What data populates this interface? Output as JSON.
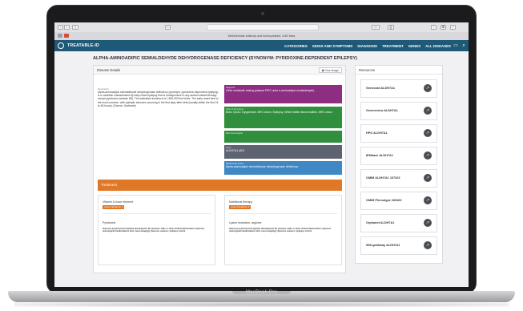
{
  "browser": {
    "tab_title": "Methotrexate antibody and homocysteine, LMD floss",
    "laptop_label": "MacBook Pro"
  },
  "nav": {
    "brand": "TREATABLE-ID",
    "links": [
      "CATEGORIES",
      "SIGNS AND SYMPTOMS",
      "DIAGNOSIS",
      "TREATMENT",
      "GENES",
      "ALL DISEASES"
    ]
  },
  "page": {
    "title": "ALPHA-AMINOADIPIC SEMIALDEHYDE DEHYDROGENASE DEFICIENCY (SYNONYM: PYRIDOXINE-DEPENDENT EPILEPSY)"
  },
  "details": {
    "header": "Disease Details",
    "your_image_button": "Your Image",
    "description_label": "Description",
    "description": "Alpha-aminoadipic semialdehyde dehydrogenase deficiency (synonym: pyridoxine-dependent epilepsy) is a condition characterized by early onset epilepsy that is unresponsive to any anticonvulsant therapy except pyridoxine (vitamin B6). The estimated incidence is 1:500,000 live births. The early onset form is the most common, with epileptic seizures occurring in the first days after birth (usually within the first 24 to 48 hours). (Source: Orphanet)",
    "tags": [
      {
        "label": "Diagnosis",
        "value": "Other metabolic testing (plasma PIPC urine α-aminoadipic semialdehyde)",
        "color": "#8e2e82"
      },
      {
        "label": "Signs & Symptoms",
        "value": "Brain Cysts / Dysgenesis; MRI Lesion; Epilepsy; White Matter Abnormalities; MRI Lesion",
        "color": "#2f8f3c"
      },
      {
        "label": "Main Neurological",
        "value": "",
        "color": "#2f8f3c"
      },
      {
        "label": "Gene",
        "value": "ALDH7A1 (AR)",
        "color": "#5d6370"
      },
      {
        "label": "Biochemical Lesion",
        "value": "Alpha-aminoadipic semialdehyde dehydrogenase deficiency",
        "color": "#3f88c5"
      }
    ],
    "treatment_header": "Treatment",
    "treatments": [
      {
        "category": "Vitamin & trace element",
        "evidence": "Level of Evidence: 2",
        "name": "Pyridoxine",
        "effect": "Improves psychomotor/cognitive development; ID; prevents, halts or slows clinical deterioration; improves neurological manifestations (incl. neuro-imaging); improves seizures / epilepsy control"
      },
      {
        "category": "Nutritional therapy",
        "evidence": "Level of Evidence: 4",
        "name": "Lysine restriction; arginine",
        "effect": "Improves psychomotor/cognitive development; ID; prevents, halts or slows clinical deterioration; improves neurological manifestations (incl. neuro-imaging); improves seizures / epilepsy control"
      }
    ]
  },
  "resources": {
    "header": "Resources",
    "items": [
      "Genecard ALDH7A1",
      "Genereview ALDH7A1",
      "HPO ALDH7A1",
      "IEMbase ALDH7A1",
      "OMIM ALDH7A1 107323",
      "OMIM Phenotype 266100",
      "Orphanet ALDH7A1",
      "Wiki-pathway ALDH7A1"
    ]
  },
  "colors": {
    "nav": "#1e5a78",
    "treatment_accent": "#e07828"
  }
}
